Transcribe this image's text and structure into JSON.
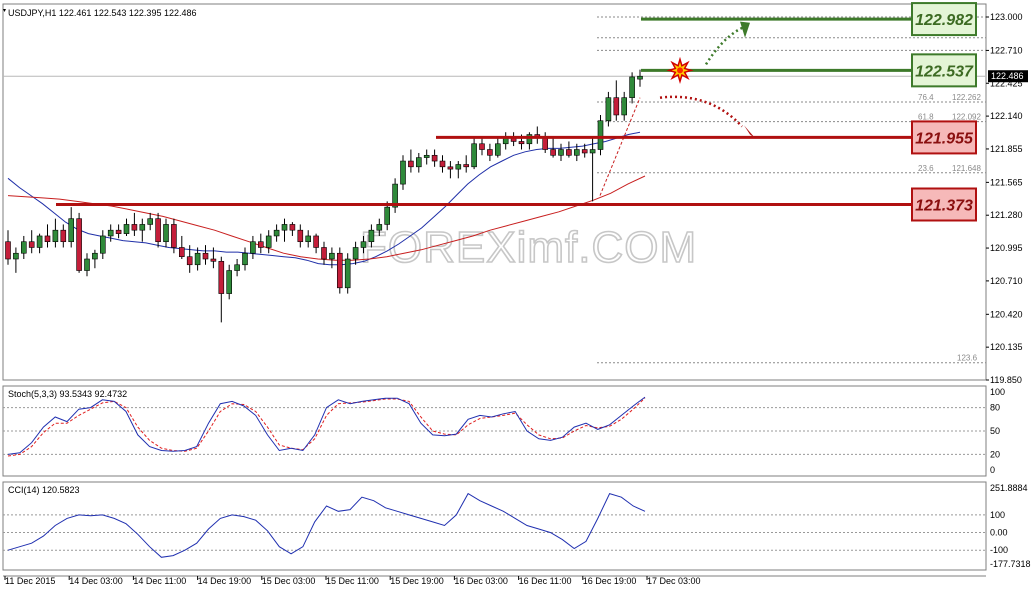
{
  "colors": {
    "bull": "#2f8a3a",
    "bear": "#c41e3a",
    "candle_outline": "#000000",
    "ma_fast": "#1f2fa8",
    "ma_slow": "#c81f1f",
    "resistance_line": "#3d7a2a",
    "support_line": "#b01010",
    "resistance_label_bg": "#e4f5d6",
    "support_label_bg": "#f6b9b9",
    "resistance_text": "#3d6b23",
    "support_text": "#8a0f0f",
    "stoch_main": "#2030b0",
    "stoch_signal": "#e02020",
    "cci": "#2030b0",
    "watermark": "#c7c7c7"
  },
  "header": {
    "symbol_info": "USDJPY,H1  122.461 122.543 122.395 122.486"
  },
  "watermark": {
    "text": "FOREXimf.COM"
  },
  "chart_data": [
    {
      "type": "candlestick",
      "symbol": "USDJPY",
      "timeframe": "H1",
      "ohlc_header": {
        "open": 122.461,
        "high": 122.543,
        "low": 122.395,
        "close": 122.486
      },
      "current_price": "122.486",
      "ylim": [
        119.85,
        123.0
      ],
      "y_ticks": [
        "123.000",
        "122.710",
        "122.425",
        "122.140",
        "121.855",
        "121.565",
        "121.280",
        "120.995",
        "120.710",
        "120.420",
        "120.135",
        "119.850"
      ],
      "x_ticks": [
        "11 Dec 2015",
        "14 Dec 03:00",
        "14 Dec 11:00",
        "14 Dec 19:00",
        "15 Dec 03:00",
        "15 Dec 11:00",
        "15 Dec 19:00",
        "16 Dec 03:00",
        "16 Dec 11:00",
        "16 Dec 19:00",
        "17 Dec 03:00"
      ],
      "candles": [
        [
          121.05,
          121.15,
          120.85,
          120.9
        ],
        [
          120.9,
          121.0,
          120.78,
          120.95
        ],
        [
          120.95,
          121.1,
          120.9,
          121.05
        ],
        [
          121.05,
          121.15,
          120.95,
          121.0
        ],
        [
          121.0,
          121.12,
          120.95,
          121.1
        ],
        [
          121.1,
          121.2,
          121.0,
          121.05
        ],
        [
          121.05,
          121.25,
          121.0,
          121.15
        ],
        [
          121.15,
          121.2,
          121.0,
          121.05
        ],
        [
          121.05,
          121.35,
          121.0,
          121.25
        ],
        [
          121.25,
          121.3,
          120.78,
          120.8
        ],
        [
          120.8,
          120.95,
          120.75,
          120.9
        ],
        [
          120.9,
          120.98,
          120.82,
          120.95
        ],
        [
          120.95,
          121.15,
          120.9,
          121.1
        ],
        [
          121.1,
          121.2,
          121.05,
          121.15
        ],
        [
          121.15,
          121.2,
          121.08,
          121.12
        ],
        [
          121.12,
          121.25,
          121.1,
          121.2
        ],
        [
          121.2,
          121.3,
          121.1,
          121.15
        ],
        [
          121.15,
          121.25,
          121.05,
          121.2
        ],
        [
          121.2,
          121.3,
          121.15,
          121.25
        ],
        [
          121.25,
          121.3,
          121.0,
          121.05
        ],
        [
          121.05,
          121.25,
          121.0,
          121.2
        ],
        [
          121.2,
          121.25,
          120.95,
          121.0
        ],
        [
          121.0,
          121.1,
          120.9,
          120.92
        ],
        [
          120.92,
          121.02,
          120.78,
          120.85
        ],
        [
          120.85,
          121.0,
          120.8,
          120.95
        ],
        [
          120.95,
          121.02,
          120.85,
          120.9
        ],
        [
          120.9,
          121.0,
          120.82,
          120.88
        ],
        [
          120.88,
          120.92,
          120.35,
          120.6
        ],
        [
          120.6,
          120.85,
          120.55,
          120.8
        ],
        [
          120.8,
          120.9,
          120.75,
          120.85
        ],
        [
          120.85,
          121.0,
          120.8,
          120.95
        ],
        [
          120.95,
          121.1,
          120.9,
          121.05
        ],
        [
          121.05,
          121.12,
          120.95,
          121.0
        ],
        [
          121.0,
          121.15,
          120.95,
          121.1
        ],
        [
          121.1,
          121.2,
          121.05,
          121.15
        ],
        [
          121.15,
          121.25,
          121.05,
          121.2
        ],
        [
          121.2,
          121.22,
          121.1,
          121.15
        ],
        [
          121.15,
          121.2,
          121.0,
          121.05
        ],
        [
          121.05,
          121.15,
          121.0,
          121.1
        ],
        [
          121.1,
          121.12,
          120.95,
          121.0
        ],
        [
          121.0,
          121.05,
          120.85,
          120.9
        ],
        [
          120.9,
          121.0,
          120.82,
          120.95
        ],
        [
          120.95,
          121.0,
          120.6,
          120.65
        ],
        [
          120.65,
          120.95,
          120.6,
          120.9
        ],
        [
          120.9,
          121.05,
          120.85,
          121.0
        ],
        [
          121.0,
          121.1,
          120.95,
          121.05
        ],
        [
          121.05,
          121.2,
          121.0,
          121.15
        ],
        [
          121.15,
          121.25,
          121.1,
          121.2
        ],
        [
          121.2,
          121.4,
          121.15,
          121.35
        ],
        [
          121.35,
          121.6,
          121.3,
          121.55
        ],
        [
          121.55,
          121.8,
          121.5,
          121.75
        ],
        [
          121.75,
          121.85,
          121.65,
          121.7
        ],
        [
          121.7,
          121.82,
          121.65,
          121.78
        ],
        [
          121.78,
          121.85,
          121.72,
          121.8
        ],
        [
          121.8,
          121.85,
          121.7,
          121.75
        ],
        [
          121.75,
          121.8,
          121.65,
          121.7
        ],
        [
          121.7,
          121.75,
          121.6,
          121.68
        ],
        [
          121.68,
          121.75,
          121.6,
          121.72
        ],
        [
          121.72,
          121.8,
          121.65,
          121.7
        ],
        [
          121.7,
          121.95,
          121.68,
          121.9
        ],
        [
          121.9,
          121.95,
          121.8,
          121.85
        ],
        [
          121.85,
          121.9,
          121.75,
          121.8
        ],
        [
          121.8,
          121.95,
          121.78,
          121.9
        ],
        [
          121.9,
          122.0,
          121.85,
          121.95
        ],
        [
          121.95,
          122.0,
          121.88,
          121.92
        ],
        [
          121.92,
          121.98,
          121.85,
          121.9
        ],
        [
          121.9,
          122.0,
          121.85,
          121.98
        ],
        [
          121.98,
          122.05,
          121.9,
          121.95
        ],
        [
          121.95,
          122.0,
          121.82,
          121.85
        ],
        [
          121.85,
          121.95,
          121.78,
          121.8
        ],
        [
          121.8,
          121.9,
          121.75,
          121.85
        ],
        [
          121.85,
          121.92,
          121.78,
          121.8
        ],
        [
          121.8,
          121.9,
          121.75,
          121.85
        ],
        [
          121.85,
          121.9,
          121.78,
          121.82
        ],
        [
          121.82,
          121.95,
          121.4,
          121.85
        ],
        [
          121.85,
          122.15,
          121.8,
          122.1
        ],
        [
          122.1,
          122.35,
          122.05,
          122.3
        ],
        [
          122.3,
          122.45,
          122.1,
          122.15
        ],
        [
          122.15,
          122.35,
          122.1,
          122.3
        ],
        [
          122.3,
          122.52,
          122.25,
          122.48
        ],
        [
          122.461,
          122.543,
          122.395,
          122.486
        ]
      ],
      "ma_fast": [
        121.6,
        121.52,
        121.45,
        121.38,
        121.3,
        121.22,
        121.16,
        121.12,
        121.1,
        121.08,
        121.06,
        121.05,
        121.04,
        121.02,
        121.0,
        120.99,
        120.98,
        120.97,
        120.97,
        120.96,
        120.96,
        120.95,
        120.94,
        120.93,
        120.92,
        120.91,
        120.89,
        120.86,
        120.85,
        120.85,
        120.86,
        120.88,
        120.92,
        120.97,
        121.03,
        121.1,
        121.17,
        121.26,
        121.35,
        121.45,
        121.55,
        121.63,
        121.7,
        121.75,
        121.8,
        121.83,
        121.85,
        121.86,
        121.86,
        121.87,
        121.88,
        121.9,
        121.92,
        121.95,
        121.98,
        122.0
      ],
      "ma_slow": [
        121.45,
        121.44,
        121.43,
        121.42,
        121.4,
        121.38,
        121.36,
        121.33,
        121.3,
        121.27,
        121.23,
        121.19,
        121.15,
        121.1,
        121.05,
        121.0,
        120.95,
        120.92,
        120.9,
        120.89,
        120.89,
        120.9,
        120.92,
        120.95,
        120.98,
        121.02,
        121.06,
        121.1,
        121.15,
        121.19,
        121.23,
        121.27,
        121.31,
        121.36,
        121.41,
        121.47,
        121.55,
        121.62
      ],
      "fibonacci": [
        {
          "label": "123.6",
          "value": "120.0"
        },
        {
          "label": "76.4",
          "value": "122.262"
        },
        {
          "label": "61.8",
          "value": "122.092"
        },
        {
          "label": "23.6",
          "value": "121.648"
        }
      ],
      "annotations": {
        "target_line": {
          "label": "122.982",
          "value": 122.982
        },
        "resistance_line": {
          "label": "122.537",
          "value": 122.537
        },
        "support_line_1": {
          "label": "121.955",
          "value": 121.955
        },
        "support_line_2": {
          "label": "121.373",
          "value": 121.373
        }
      }
    },
    {
      "type": "line",
      "title": "Stoch(5,3,3) 93.5343 92.4732",
      "ylim": [
        0,
        100
      ],
      "y_ticks": [
        "100",
        "80",
        "50",
        "20",
        "0"
      ],
      "series": [
        {
          "name": "main",
          "values": [
            20,
            22,
            35,
            55,
            68,
            62,
            78,
            80,
            90,
            88,
            75,
            45,
            30,
            25,
            24,
            25,
            30,
            60,
            85,
            88,
            82,
            70,
            45,
            25,
            28,
            25,
            45,
            80,
            90,
            85,
            88,
            90,
            92,
            92,
            85,
            60,
            45,
            44,
            46,
            65,
            70,
            68,
            72,
            75,
            50,
            40,
            38,
            42,
            55,
            60,
            52,
            58,
            70,
            82,
            93.5
          ]
        },
        {
          "name": "signal",
          "values": [
            18,
            20,
            30,
            48,
            60,
            60,
            70,
            78,
            86,
            88,
            80,
            55,
            38,
            28,
            25,
            24,
            28,
            50,
            75,
            85,
            84,
            75,
            55,
            32,
            28,
            26,
            40,
            70,
            85,
            86,
            87,
            89,
            91,
            91,
            88,
            68,
            50,
            46,
            45,
            58,
            66,
            68,
            70,
            73,
            58,
            45,
            40,
            41,
            50,
            57,
            54,
            56,
            65,
            78,
            92.5
          ]
        }
      ]
    },
    {
      "type": "line",
      "title": "CCI(14) 120.5823",
      "ylim": [
        -177.7318,
        251.8884
      ],
      "y_ticks": [
        "251.8884",
        "100",
        "0.00",
        "-100",
        "-177.7318"
      ],
      "series": [
        {
          "name": "cci",
          "values": [
            -100,
            -80,
            -60,
            -20,
            40,
            80,
            100,
            95,
            100,
            80,
            50,
            -10,
            -80,
            -140,
            -130,
            -100,
            -60,
            20,
            80,
            100,
            90,
            70,
            10,
            -80,
            -120,
            -80,
            60,
            150,
            120,
            130,
            200,
            180,
            140,
            120,
            100,
            80,
            60,
            40,
            100,
            220,
            180,
            150,
            120,
            80,
            40,
            20,
            0,
            -40,
            -90,
            -50,
            80,
            220,
            200,
            150,
            120
          ]
        }
      ]
    }
  ]
}
